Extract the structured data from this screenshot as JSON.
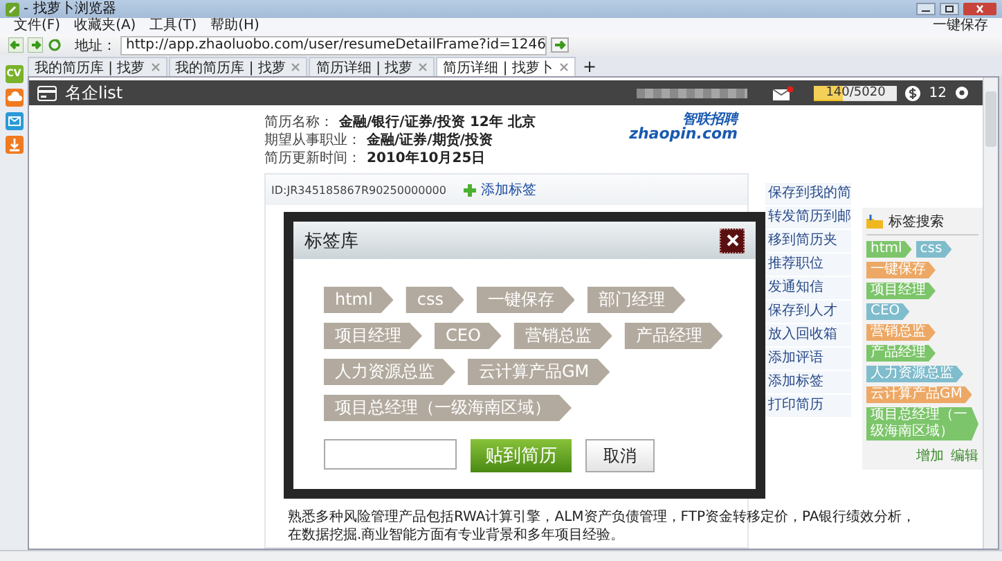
{
  "window": {
    "title": "- 找萝卜浏览器"
  },
  "menu": [
    "文件(F)",
    "收藏夹(A)",
    "工具(T)",
    "帮助(H)"
  ],
  "toolbar_right": "一键保存",
  "address": {
    "label": "地址：",
    "value": "http://app.zhaoluobo.com/user/resumeDetailFrame?id=1246"
  },
  "tabs": [
    {
      "label": "我的简历库 | 找萝",
      "selected": false
    },
    {
      "label": "我的简历库 | 找萝",
      "selected": false
    },
    {
      "label": "简历详细 | 找萝",
      "selected": false
    },
    {
      "label": "简历详细 | 找萝卜",
      "selected": true
    }
  ],
  "new_tab": "+",
  "side_badge": "CV",
  "header": {
    "title": "名企list",
    "mail_unread": true,
    "quota": {
      "level": 0.35,
      "reading": "140/5020"
    },
    "coins": "12"
  },
  "resume": {
    "fields": [
      {
        "label": "简历名称：",
        "value": "金融/银行/证券/投资 12年 北京"
      },
      {
        "label": "期望从事职业：",
        "value": "金融/证券/期货/投资"
      },
      {
        "label": "简历更新时间：",
        "value": "2010年10月25日"
      }
    ],
    "logo": {
      "cn": "智联招聘",
      "en": "zhaopin.com"
    },
    "id": "ID:JR345185867R90250000000",
    "add_tag": "添加标签",
    "summary": [
      "熟悉多种风险管理产品包括RWA计算引擎，ALM资产负债管理，FTP资金转移定价，PA银行绩效分析，",
      "在数据挖掘.商业智能方面有专业背景和多年项目经验。"
    ]
  },
  "actions": [
    "保存到我的简",
    "转发简历到邮",
    "移到简历夹",
    "推荐职位",
    "发通知信",
    "保存到人才",
    "放入回收箱",
    "添加评语",
    "添加标签",
    "打印简历"
  ],
  "tag_search": {
    "title": "标签搜索",
    "tags": [
      {
        "label": "html",
        "color": "#7cc56a"
      },
      {
        "label": "css",
        "color": "#7fbccc"
      },
      {
        "label": "一键保存",
        "color": "#eda865"
      },
      {
        "label": "项目经理",
        "color": "#7cc56a"
      },
      {
        "label": "CEO",
        "color": "#7fbccc"
      },
      {
        "label": "营销总监",
        "color": "#eda865"
      },
      {
        "label": "产品经理",
        "color": "#7cc56a"
      },
      {
        "label": "人力资源总监",
        "color": "#7fbccc"
      },
      {
        "label": "云计算产品GM",
        "color": "#eda865"
      },
      {
        "label": "项目总经理（一级海南区域）",
        "color": "#7cc56a"
      }
    ],
    "links": [
      "增加",
      "编辑"
    ]
  },
  "dialog": {
    "title": "标签库",
    "tag_rows": [
      [
        "html",
        "css",
        "一键保存",
        "部门经理"
      ],
      [
        "项目经理",
        "CEO",
        "营销总监",
        "产品经理"
      ],
      [
        "人力资源总监",
        "云计算产品GM"
      ],
      [
        "项目总经理（一级海南区域）"
      ]
    ],
    "confirm": "贴到简历",
    "cancel": "取消"
  }
}
